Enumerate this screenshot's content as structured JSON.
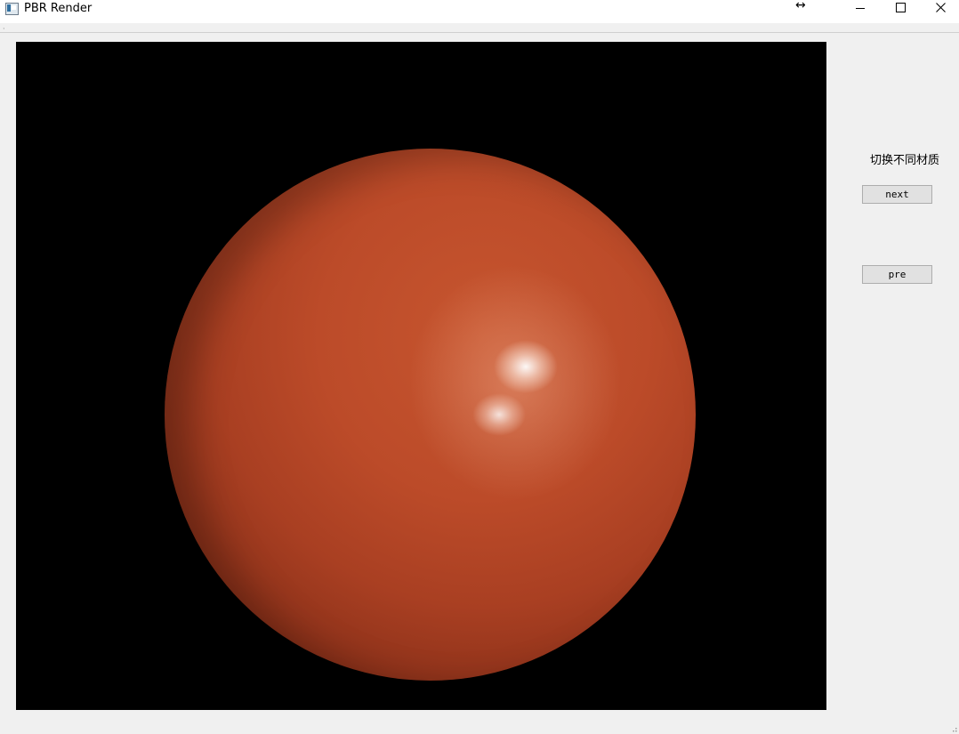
{
  "window": {
    "title": "PBR Render",
    "icons": {
      "app": "app-icon",
      "minimize": "minimize-icon",
      "maximize": "maximize-icon",
      "close": "close-icon",
      "cursor": "resize-horizontal-cursor-icon"
    },
    "resize_cursor_glyph": "↔"
  },
  "viewport": {
    "background": "#000000",
    "object": "sphere",
    "material_color": "#bc4b29"
  },
  "panel": {
    "label": "切换不同材质",
    "next_label": "next",
    "pre_label": "pre"
  }
}
